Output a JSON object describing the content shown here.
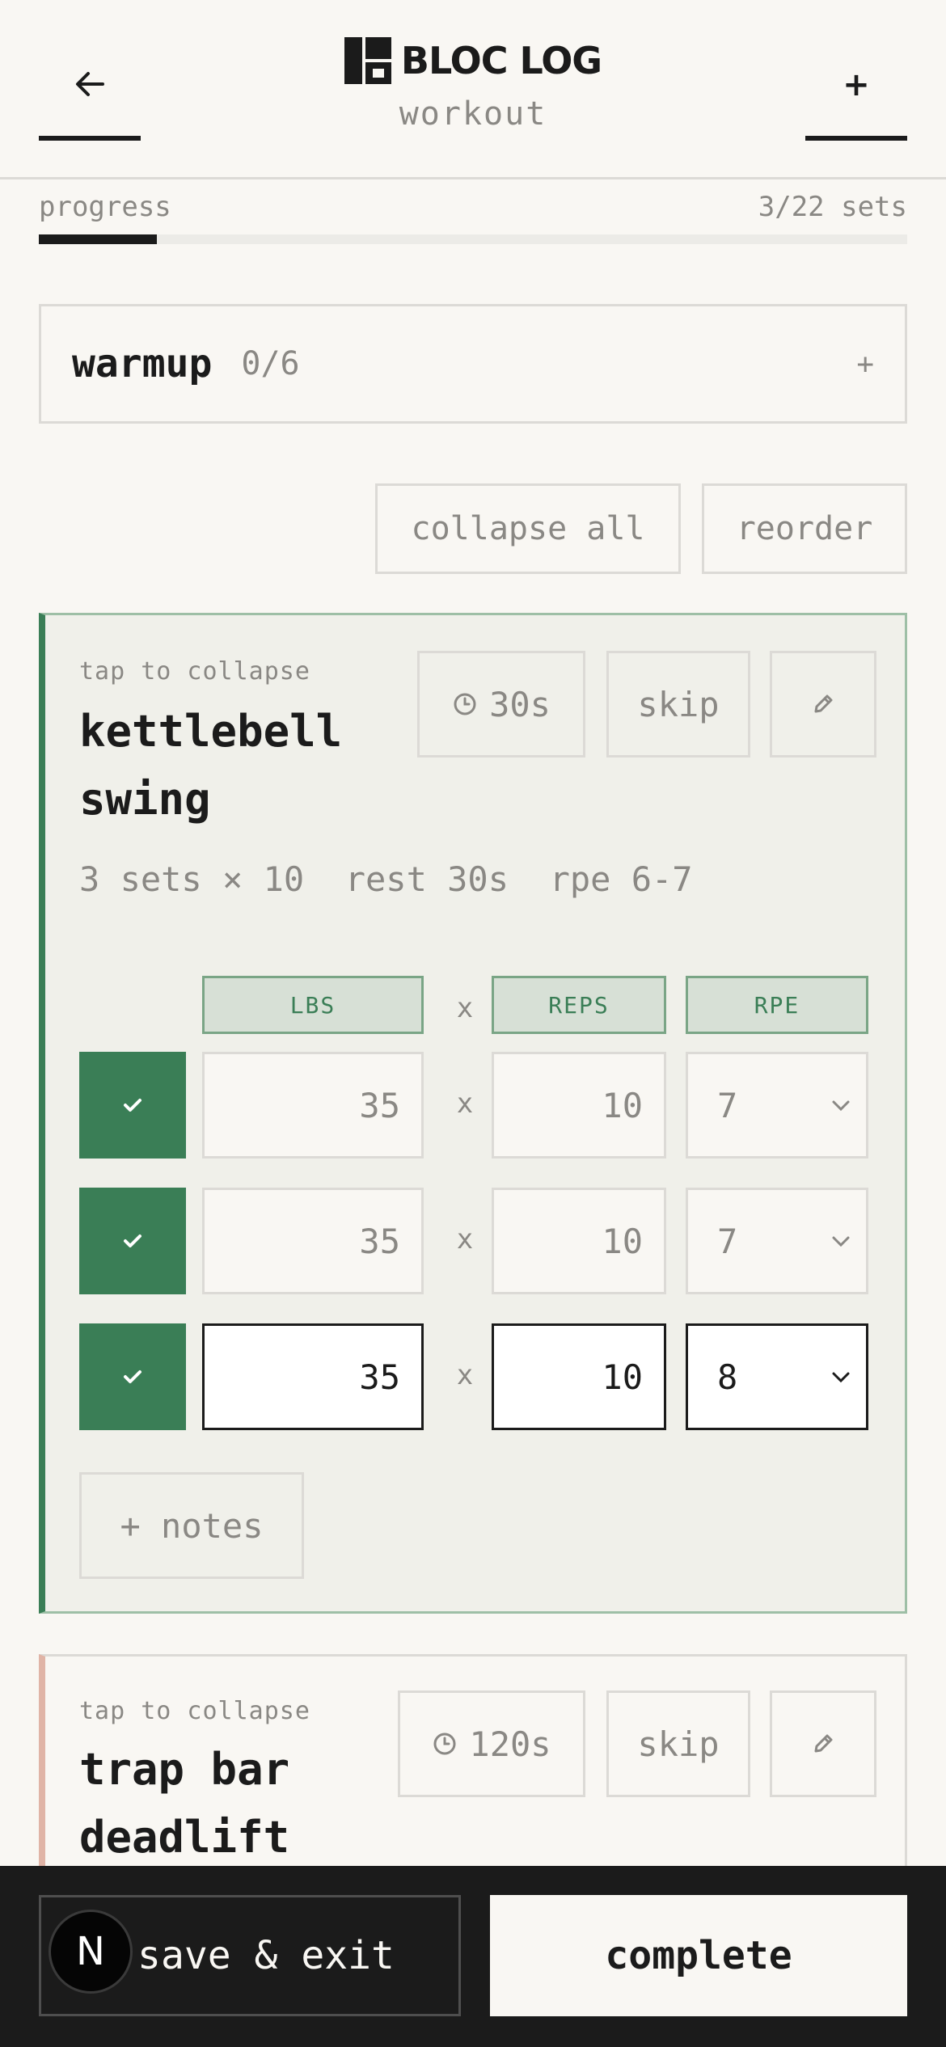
{
  "header": {
    "brand": "BLOC LOG",
    "subtitle": "workout",
    "add_label": "+"
  },
  "progress": {
    "label": "progress",
    "count_text": "3/22 sets",
    "done": 3,
    "total": 22
  },
  "warmup": {
    "title": "warmup",
    "count": "0/6",
    "toggle": "+"
  },
  "controls": {
    "collapse_all": "collapse all",
    "reorder": "reorder"
  },
  "exercises": [
    {
      "tap_hint": "tap to collapse",
      "title": "kettlebell swing",
      "timer": "30s",
      "skip": "skip",
      "meta": "3 sets × 10  rest 30s  rpe 6-7",
      "columns": {
        "weight": "LBS",
        "x": "x",
        "reps": "REPS",
        "rpe": "RPE"
      },
      "sets": [
        {
          "weight": "35",
          "reps": "10",
          "rpe": "7"
        },
        {
          "weight": "35",
          "reps": "10",
          "rpe": "7"
        },
        {
          "weight": "35",
          "reps": "10",
          "rpe": "8"
        }
      ],
      "notes": "+ notes"
    },
    {
      "tap_hint": "tap to collapse",
      "title": "trap bar deadlift",
      "timer": "120s",
      "skip": "skip"
    }
  ],
  "footer": {
    "save_exit": "save & exit",
    "complete": "complete",
    "badge": "N"
  },
  "colors": {
    "accent": "#3a7e56",
    "background": "#f9f7f3",
    "dark": "#1b1b1b",
    "muted": "#8a8884"
  }
}
